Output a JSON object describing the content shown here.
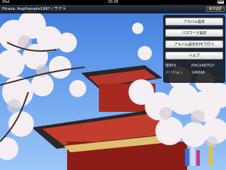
{
  "status_bar": {
    "carrier": "iPad",
    "time": "20:28"
  },
  "title_bar": {
    "title": "Picasa: itoplhanako1997 / サクラ",
    "close_label": "表示設定"
  },
  "settings_panel": {
    "buttons": [
      "アルバム設定",
      "パスワード設定",
      "アルバム設定をPCで行う",
      "ヘルプ"
    ],
    "info": [
      {
        "label": "端末ID",
        "value": "RHCXA8752?"
      },
      {
        "label": "バージョン",
        "value": "146606"
      }
    ]
  },
  "photo": {
    "subject": "cherry-blossom-pagoda"
  }
}
